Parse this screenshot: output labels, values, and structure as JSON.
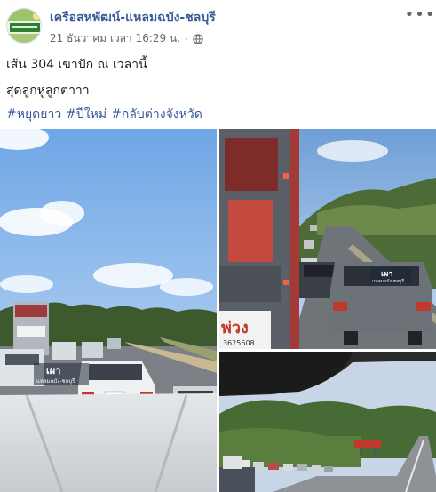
{
  "post": {
    "page_name": "เครือสหพัฒน์-แหลมฉบัง-ชลบุรี",
    "timestamp": "21 ธันวาคม เวลา 16:29 น.",
    "separator": "·",
    "audience_icon": "globe-icon",
    "more_icon": "more-options-icon",
    "more_label": "•••",
    "text_line1": "เส้น 304 เขาปัก ณ เวลานี้",
    "text_line2": "สุดลูกหูลูกตาาา",
    "hashtags": [
      "#หยุดยาว",
      "#ปีใหม่",
      "#กลับต่างจังหวัด"
    ],
    "link_color": "#365899",
    "name_color": "#385898"
  },
  "photos": {
    "photo1_sticker_top": "เผา",
    "photo1_sticker_bottom": "แหลมฉบัง-ชลบุรี",
    "photo2_sticker_top": "เผา",
    "photo2_sticker_bottom": "แหลมฉบัง-ชลบุรี",
    "photo2_truck_text": "พ่วง",
    "photo2_phone_text": "3625608"
  }
}
